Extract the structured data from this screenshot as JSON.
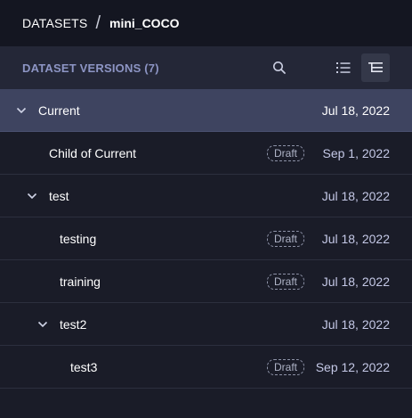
{
  "breadcrumb": {
    "root": "DATASETS",
    "separator": "/",
    "leaf": "mini_COCO"
  },
  "header": {
    "title": "DATASET VERSIONS (7)",
    "icons": [
      "search-icon",
      "list-view-icon",
      "tree-view-icon"
    ]
  },
  "colors": {
    "selected_row": "#3e4460",
    "header_title": "#8d95c4",
    "background": "#1a1c28"
  },
  "versions": [
    {
      "name": "Current",
      "date": "Jul 18, 2022",
      "badge": "",
      "expanded": true,
      "selected": true,
      "depth": 0
    },
    {
      "name": "Child of Current",
      "date": "Sep 1, 2022",
      "badge": "Draft",
      "expanded": false,
      "selected": false,
      "depth": 1
    },
    {
      "name": "test",
      "date": "Jul 18, 2022",
      "badge": "",
      "expanded": true,
      "selected": false,
      "depth": 1
    },
    {
      "name": "testing",
      "date": "Jul 18, 2022",
      "badge": "Draft",
      "expanded": false,
      "selected": false,
      "depth": 2
    },
    {
      "name": "training",
      "date": "Jul 18, 2022",
      "badge": "Draft",
      "expanded": false,
      "selected": false,
      "depth": 2
    },
    {
      "name": "test2",
      "date": "Jul 18, 2022",
      "badge": "",
      "expanded": true,
      "selected": false,
      "depth": 2
    },
    {
      "name": "test3",
      "date": "Sep 12, 2022",
      "badge": "Draft",
      "expanded": false,
      "selected": false,
      "depth": 3
    }
  ]
}
